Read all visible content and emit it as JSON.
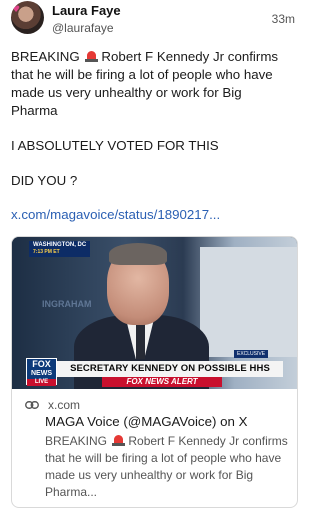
{
  "post": {
    "author_name": "Laura Faye",
    "author_handle": "@laurafaye",
    "time": "33m",
    "lines": {
      "l1_a": "BREAKING",
      "l1_b": "Robert F Kennedy Jr confirms",
      "l2": "that he will be firing a lot of people who have",
      "l3": "made us very unhealthy or work for Big",
      "l4": "Pharma",
      "l5": "I ABSOLUTELY VOTED FOR THIS",
      "l6": "DID YOU ?"
    },
    "link": "x.com/magavoice/status/1890217..."
  },
  "card": {
    "thumbnail": {
      "location": "WASHINGTON, DC",
      "location_time": "7:13 PM ET",
      "show": "INGRAHAM",
      "exclusive": "EXCLUSIVE",
      "logo_line1": "FOX",
      "logo_line2": "NEWS",
      "logo_line3": "LIVE",
      "headline": "SECRETARY KENNEDY ON POSSIBLE HHS CUTS",
      "alert": "FOX NEWS ALERT"
    },
    "domain": "x.com",
    "title": "MAGA Voice (@MAGAVoice) on X",
    "desc": {
      "l1_a": "BREAKING",
      "l1_b": "Robert F Kennedy Jr confirms",
      "l2": "that he will be firing a lot of people who have",
      "l3": "made us very unhealthy or work for Big",
      "l4": "Pharma..."
    }
  },
  "icons": {
    "siren": "police-light-emoji",
    "link": "link-icon"
  },
  "colors": {
    "link": "#2a5fb3",
    "secondary_text": "#555555",
    "siren": "#e53935"
  }
}
